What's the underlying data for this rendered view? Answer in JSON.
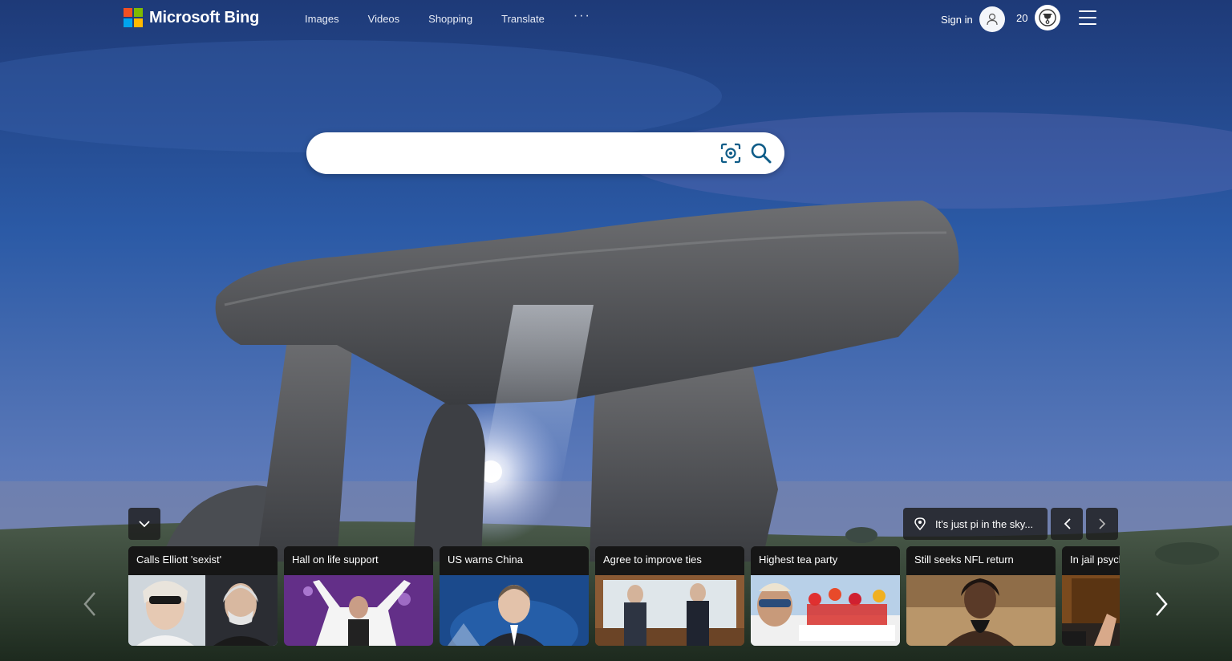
{
  "header": {
    "brand": "Microsoft Bing",
    "brand_colors": [
      "#f25022",
      "#7fba00",
      "#00a4ef",
      "#ffb900"
    ],
    "nav": [
      {
        "label": "Images"
      },
      {
        "label": "Videos"
      },
      {
        "label": "Shopping"
      },
      {
        "label": "Translate"
      }
    ],
    "more_label": "···",
    "signin_label": "Sign in",
    "rewards_count": "20"
  },
  "search": {
    "value": "",
    "placeholder": "",
    "accent": "#0e5c88"
  },
  "image_info": {
    "location_text": "It's just pi in the sky..."
  },
  "news": [
    {
      "title": "Calls Elliott 'sexist'"
    },
    {
      "title": "Hall on life support"
    },
    {
      "title": "US warns China"
    },
    {
      "title": "Agree to improve ties"
    },
    {
      "title": "Highest tea party"
    },
    {
      "title": "Still seeks NFL return"
    },
    {
      "title": "In jail psych"
    }
  ],
  "icons": {
    "collapse": "chevron-down-icon",
    "location": "location-pin-icon",
    "prev": "chevron-left-icon",
    "next": "chevron-right-icon",
    "visual_search": "visual-search-icon",
    "search": "search-icon",
    "menu": "hamburger-menu-icon",
    "rewards": "trophy-icon",
    "avatar": "user-icon"
  }
}
